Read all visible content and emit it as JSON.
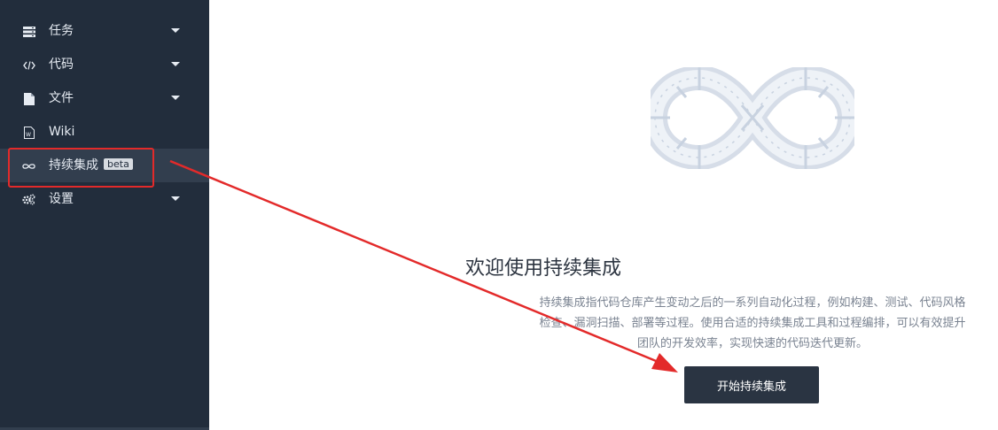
{
  "sidebar": {
    "items": [
      {
        "label": "任务",
        "icon": "server-stack-icon",
        "has_caret": true
      },
      {
        "label": "代码",
        "icon": "code-icon",
        "has_caret": true
      },
      {
        "label": "文件",
        "icon": "file-icon",
        "has_caret": true
      },
      {
        "label": "Wiki",
        "icon": "wiki-document-icon",
        "has_caret": false
      },
      {
        "label": "持续集成",
        "icon": "infinity-icon",
        "has_caret": false,
        "badge": "beta",
        "active": true
      },
      {
        "label": "设置",
        "icon": "gears-icon",
        "has_caret": true
      }
    ]
  },
  "main": {
    "title": "欢迎使用持续集成",
    "description": "持续集成指代码仓库产生变动之后的一系列自动化过程，例如构建、测试、代码风格检查、漏洞扫描、部署等过程。使用合适的持续集成工具和过程编排，可以有效提升团队的开发效率，实现快速的代码迭代更新。",
    "cta_label": "开始持续集成",
    "illustration": "infinity-pipe-illustration"
  },
  "annotation": {
    "color": "#e32a2a",
    "highlight_target": "持续集成"
  },
  "colors": {
    "sidebar_bg": "#222d3c",
    "sidebar_active_bg": "#323e4e",
    "button_bg": "#2a3442"
  }
}
